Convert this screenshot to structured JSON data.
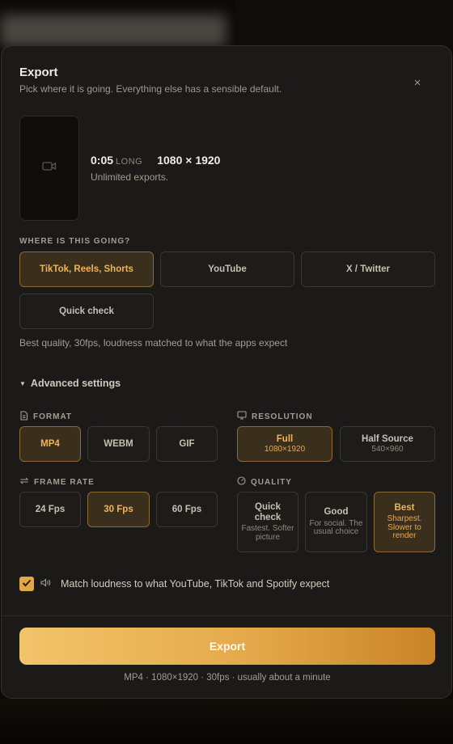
{
  "dialog": {
    "title": "Export",
    "subtitle": "Pick where it is going. Everything else has a sensible default.",
    "close_symbol": "×"
  },
  "preview": {
    "icon": "video-camera-icon",
    "duration": "0:05",
    "length_tag": "LONG",
    "dimensions": "1080 × 1920",
    "subtext": "Unlimited exports."
  },
  "destination": {
    "label": "WHERE IS THIS GOING?",
    "options": [
      {
        "label": "TikTok, Reels, Shorts",
        "selected": true
      },
      {
        "label": "YouTube",
        "selected": false
      },
      {
        "label": "X / Twitter",
        "selected": false
      },
      {
        "label": "Quick check",
        "selected": false
      }
    ],
    "hint": "Best quality, 30fps, loudness matched to what the apps expect"
  },
  "advanced": {
    "label": "Advanced settings",
    "expanded": true,
    "format": {
      "label": "FORMAT",
      "icon": "file-icon",
      "options": [
        {
          "label": "MP4",
          "selected": true
        },
        {
          "label": "WEBM",
          "selected": false
        },
        {
          "label": "GIF",
          "selected": false
        }
      ]
    },
    "resolution": {
      "label": "RESOLUTION",
      "icon": "monitor-icon",
      "options": [
        {
          "label": "Full",
          "sub": "1080×1920",
          "selected": true
        },
        {
          "label": "Half Source",
          "sub": "540×960",
          "selected": false
        }
      ]
    },
    "frame_rate": {
      "label": "FRAME RATE",
      "icon": "repeat-icon",
      "options": [
        {
          "label": "24 Fps",
          "selected": false
        },
        {
          "label": "30 Fps",
          "selected": true
        },
        {
          "label": "60 Fps",
          "selected": false
        }
      ]
    },
    "quality": {
      "label": "QUALITY",
      "icon": "gauge-icon",
      "options": [
        {
          "label": "Quick check",
          "sub": "Fastest. Softer picture",
          "selected": false
        },
        {
          "label": "Good",
          "sub": "For social. The usual choice",
          "selected": false
        },
        {
          "label": "Best",
          "sub": "Sharpest. Slower to render",
          "selected": true
        }
      ]
    }
  },
  "loudness": {
    "checked": true,
    "icon": "speaker-icon",
    "label": "Match loudness to what YouTube, TikTok and Spotify expect"
  },
  "export": {
    "button_label": "Export",
    "summary": "MP4 · 1080×1920 · 30fps · usually about a minute"
  },
  "colors": {
    "accent": "#e2a848",
    "selected_bg": "#3a2e1c",
    "selected_border": "#8c6a33",
    "selected_text": "#f0b458",
    "panel_bg": "#1b1a18"
  }
}
